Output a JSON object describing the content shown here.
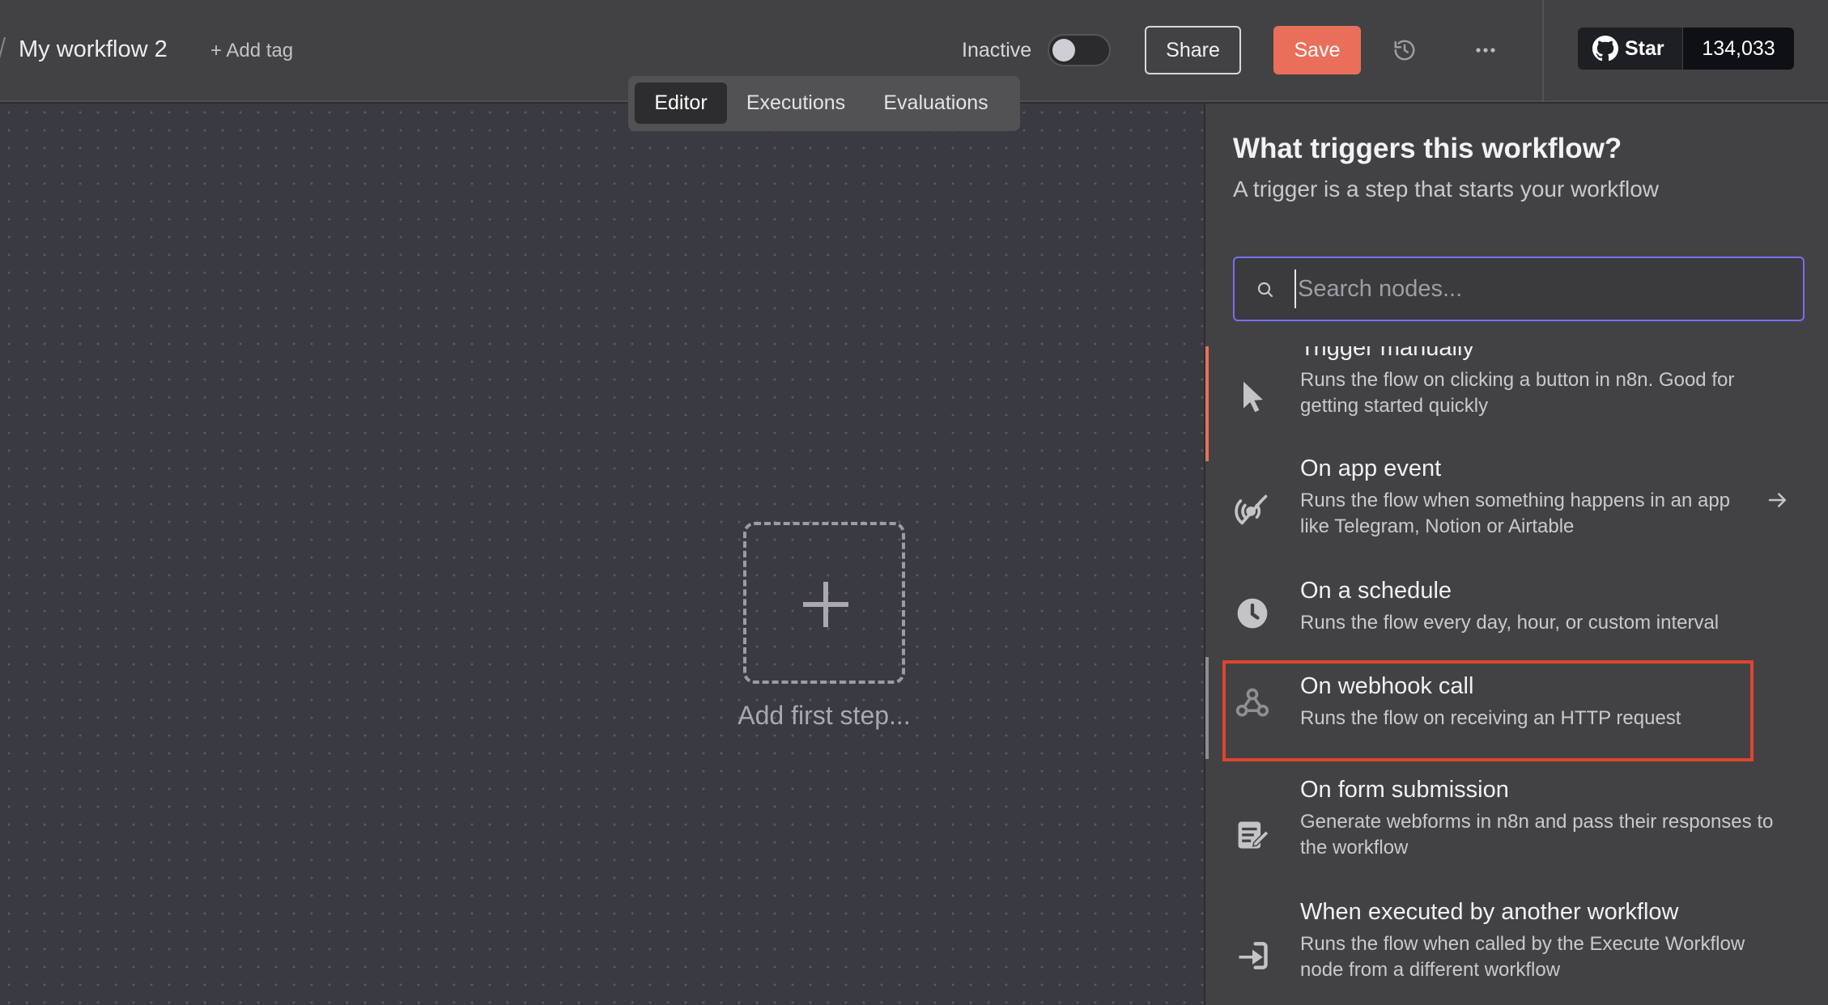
{
  "header": {
    "workflow_name": "My workflow 2",
    "add_tag": "+ Add tag",
    "status_label": "Inactive",
    "share_label": "Share",
    "save_label": "Save",
    "history_icon": "history-icon",
    "more_icon": "more-horizontal-icon",
    "github_star_label": "Star",
    "github_star_count": "134,033"
  },
  "tabs": [
    {
      "label": "Editor",
      "active": true
    },
    {
      "label": "Executions",
      "active": false
    },
    {
      "label": "Evaluations",
      "active": false
    }
  ],
  "canvas": {
    "add_first_step": "Add first step..."
  },
  "panel": {
    "title": "What triggers this workflow?",
    "subtitle": "A trigger is a step that starts your workflow",
    "search_placeholder": "Search nodes...",
    "items": [
      {
        "icon": "cursor-icon",
        "title": "Trigger manually",
        "description": "Runs the flow on clicking a button in n8n. Good for getting started quickly"
      },
      {
        "icon": "app-event-icon",
        "title": "On app event",
        "description": "Runs the flow when something happens in an app like Telegram, Notion or Airtable"
      },
      {
        "icon": "clock-icon",
        "title": "On a schedule",
        "description": "Runs the flow every day, hour, or custom interval"
      },
      {
        "icon": "webhook-icon",
        "title": "On webhook call",
        "description": "Runs the flow on receiving an HTTP request"
      },
      {
        "icon": "form-icon",
        "title": "On form submission",
        "description": "Generate webforms in n8n and pass their responses to the workflow"
      },
      {
        "icon": "sign-in-icon",
        "title": "When executed by another workflow",
        "description": "Runs the flow when called by the Execute Workflow node from a different workflow"
      }
    ]
  },
  "colors": {
    "accent_save": "#ea6f5a",
    "search_border": "#7b6df0",
    "highlight": "#e0442f"
  }
}
